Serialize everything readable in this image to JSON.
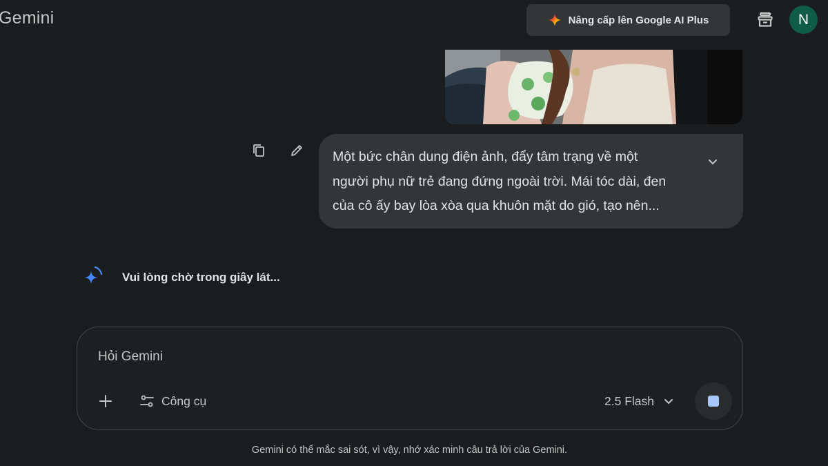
{
  "header": {
    "app_title": "Gemini",
    "upgrade_label": "Nâng cấp lên Google AI Plus",
    "avatar_initial": "N"
  },
  "conversation": {
    "user_prompt_lines": [
      "Một bức chân dung điện ảnh, đẩy tâm trạng về một",
      "người phụ nữ trẻ đang đứng ngoài trời. Mái tóc dài, đen",
      "của cô ấy bay lòa xòa qua khuôn mặt do gió, tạo nên..."
    ],
    "loading_text": "Vui lòng chờ trong giây lát..."
  },
  "input": {
    "placeholder": "Hỏi Gemini",
    "tools_label": "Công cụ",
    "model_label": "2.5 Flash"
  },
  "footer": {
    "disclaimer": "Gemini có thể mắc sai sót, vì vậy, nhớ xác minh câu trả lời của Gemini."
  },
  "colors": {
    "background": "#1b1c1d",
    "bubble": "#333537",
    "avatar": "#0f5d47",
    "accent_blue": "#4285f4",
    "stop_icon": "#a8c7fa"
  }
}
